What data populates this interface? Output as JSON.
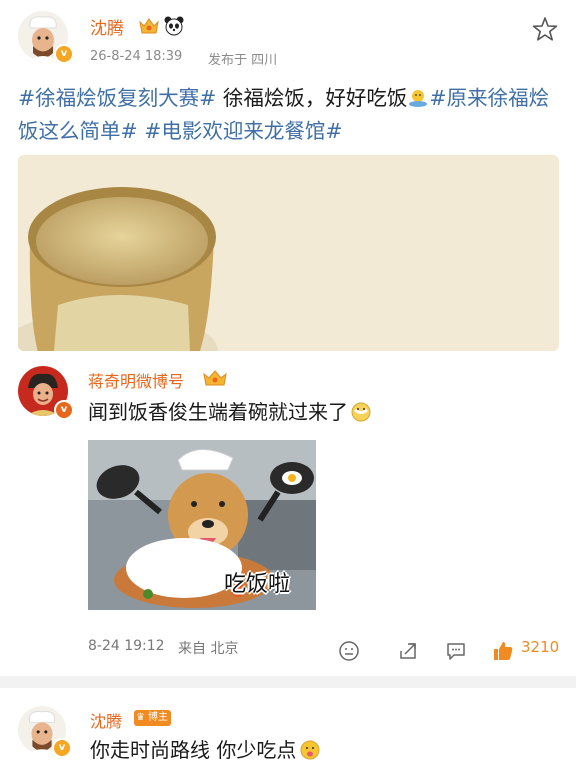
{
  "post": {
    "author": "沈腾",
    "timestamp": "26-8-24 18:39",
    "location": "发布于 四川",
    "text_segments": [
      {
        "text": "#徐福烩饭复刻大赛#",
        "type": "topic"
      },
      {
        "text": " 徐福烩饭，好好吃饭",
        "type": "plain"
      },
      {
        "text": "#原来徐福烩饭这么简单#",
        "type": "topic"
      },
      {
        "text": " ",
        "type": "plain"
      },
      {
        "text": "#电影欢迎来龙餐馆#",
        "type": "topic"
      }
    ]
  },
  "comment": {
    "author": "蒋奇明微博号",
    "text": "闻到饭香俊生端着碗就过来了",
    "meme_caption": "吃饭啦",
    "time": "8-24 19:12",
    "location": "来自 北京",
    "likes": "3210"
  },
  "reply": {
    "author": "沈腾",
    "badge": "博主",
    "text": "你走时尚路线 你少吃点"
  },
  "colors": {
    "accent": "#e8671c",
    "topic": "#3f6fa6",
    "like": "#f08a21"
  },
  "icons": [
    "star-icon",
    "crown-icon",
    "panda-icon",
    "verified-icon",
    "emoji-icon",
    "share-icon",
    "comment-icon",
    "thumbs-up-icon"
  ]
}
